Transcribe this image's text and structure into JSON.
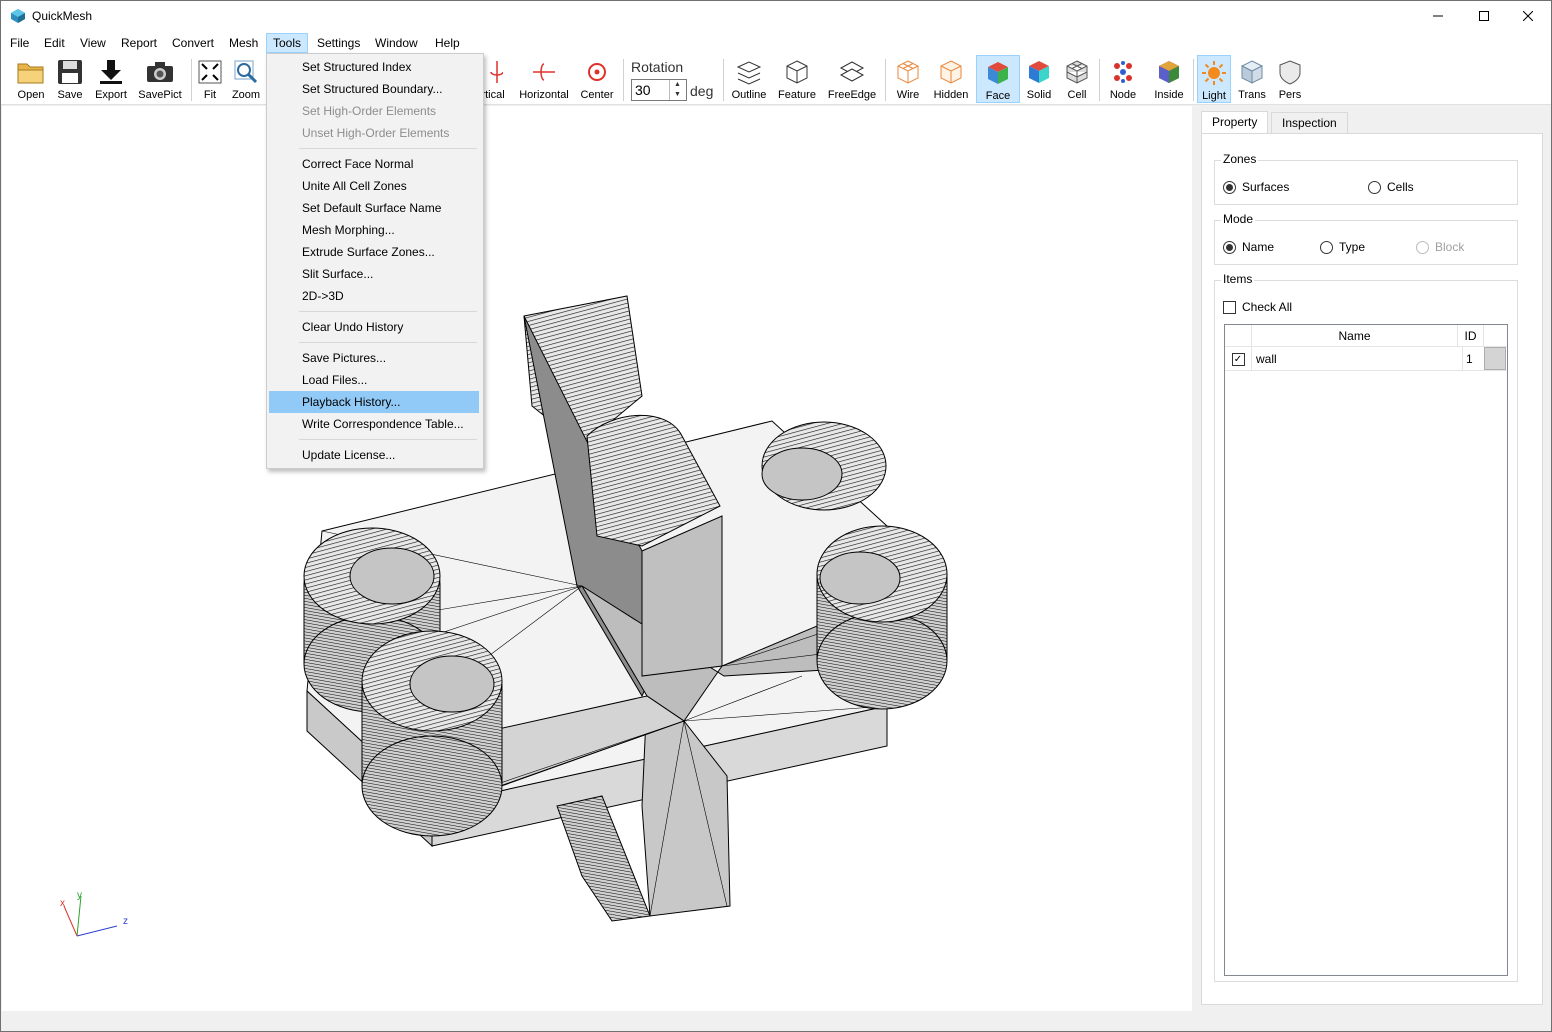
{
  "window": {
    "title": "QuickMesh"
  },
  "menu": {
    "items": [
      "File",
      "Edit",
      "View",
      "Report",
      "Convert",
      "Mesh",
      "Tools",
      "Settings",
      "Window",
      "Help"
    ],
    "active": "Tools"
  },
  "toolbar": {
    "open": "Open",
    "save": "Save",
    "export": "Export",
    "savepict": "SavePict",
    "fit": "Fit",
    "zoom": "Zoom",
    "vertical": "ertical",
    "horizontal": "Horizontal",
    "center": "Center",
    "rotation_label": "Rotation",
    "rotation_value": "30",
    "rotation_unit": "deg",
    "outline": "Outline",
    "feature": "Feature",
    "freeedge": "FreeEdge",
    "wire": "Wire",
    "hidden": "Hidden",
    "face": "Face",
    "solid": "Solid",
    "cell": "Cell",
    "node": "Node",
    "inside": "Inside",
    "light": "Light",
    "trans": "Trans",
    "pers": "Pers"
  },
  "tools_menu": {
    "groups": [
      [
        {
          "label": "Set Structured Index",
          "enabled": true
        },
        {
          "label": "Set Structured Boundary...",
          "enabled": true
        },
        {
          "label": "Set High-Order Elements",
          "enabled": false
        },
        {
          "label": "Unset High-Order Elements",
          "enabled": false
        }
      ],
      [
        {
          "label": "Correct Face Normal",
          "enabled": true
        },
        {
          "label": "Unite All Cell Zones",
          "enabled": true
        },
        {
          "label": "Set Default Surface Name",
          "enabled": true
        },
        {
          "label": "Mesh Morphing...",
          "enabled": true
        },
        {
          "label": "Extrude Surface Zones...",
          "enabled": true
        },
        {
          "label": "Slit Surface...",
          "enabled": true
        },
        {
          "label": "2D->3D",
          "enabled": true
        }
      ],
      [
        {
          "label": "Clear Undo History",
          "enabled": true
        }
      ],
      [
        {
          "label": "Save Pictures...",
          "enabled": true
        },
        {
          "label": "Load Files...",
          "enabled": true
        },
        {
          "label": "Playback History...",
          "enabled": true,
          "highlighted": true
        },
        {
          "label": "Write Correspondence Table...",
          "enabled": true
        }
      ],
      [
        {
          "label": "Update License...",
          "enabled": true
        }
      ]
    ]
  },
  "panel": {
    "tabs": [
      "Property",
      "Inspection"
    ],
    "zones": {
      "title": "Zones",
      "surfaces": "Surfaces",
      "cells": "Cells",
      "selected": "Surfaces"
    },
    "mode": {
      "title": "Mode",
      "name": "Name",
      "type": "Type",
      "block": "Block",
      "selected": "Name"
    },
    "items": {
      "title": "Items",
      "check_all": "Check All",
      "columns": [
        "Name",
        "ID"
      ],
      "rows": [
        {
          "checked": true,
          "name": "wall",
          "id": "1"
        }
      ]
    }
  },
  "axes": {
    "x": "x",
    "y": "y",
    "z": "z"
  },
  "colors": {
    "accent": "#cce8ff",
    "highlight": "#91c9f7",
    "mesh_face": "#d9d9d9"
  }
}
